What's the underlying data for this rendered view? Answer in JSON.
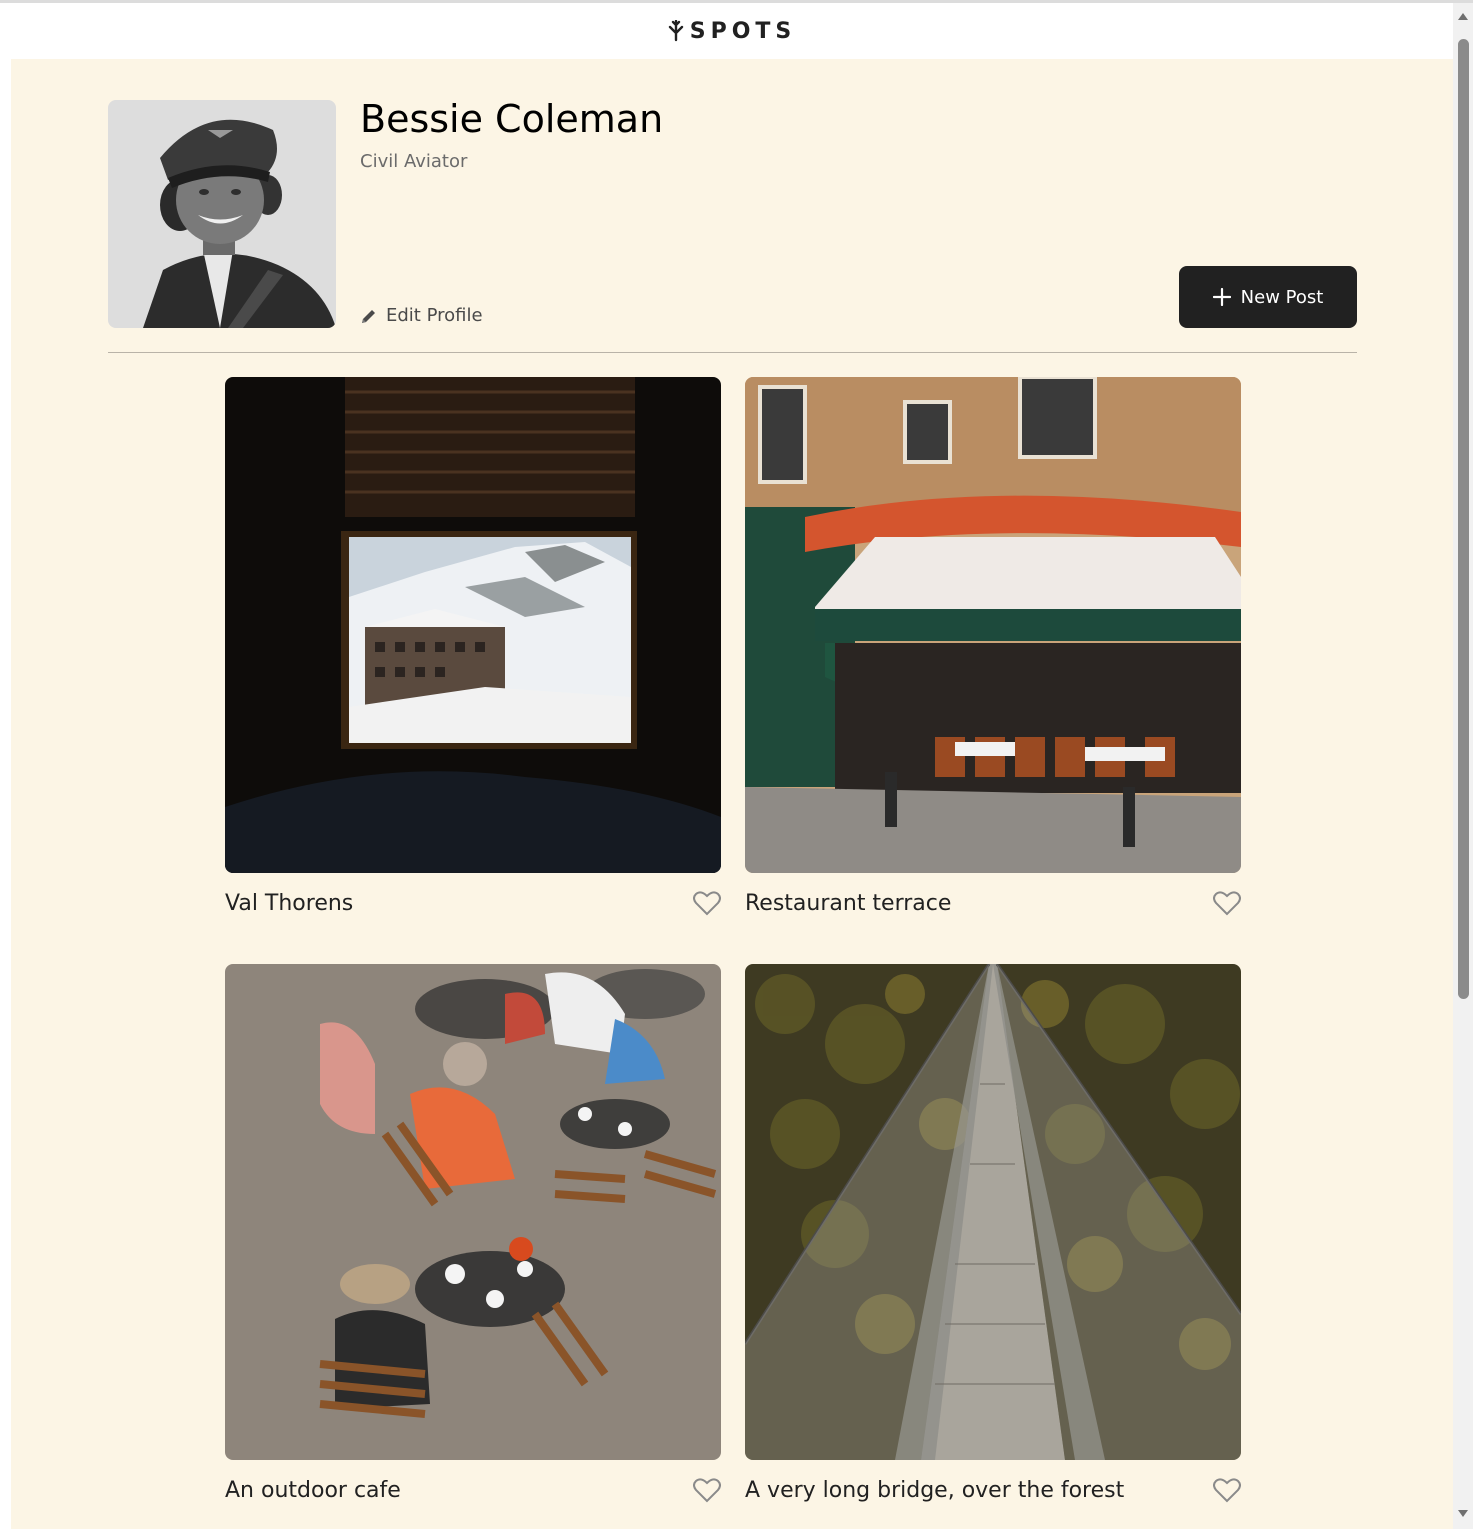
{
  "header": {
    "logo_text": "SPOTS"
  },
  "profile": {
    "name": "Bessie Coleman",
    "role": "Civil Aviator",
    "edit_label": "Edit Profile",
    "new_post_label": "New Post"
  },
  "cards": [
    {
      "title": "Val Thorens",
      "liked": false
    },
    {
      "title": "Restaurant terrace",
      "liked": false
    },
    {
      "title": "An outdoor cafe",
      "liked": false
    },
    {
      "title": "A very long bridge, over the forest",
      "liked": false
    }
  ],
  "colors": {
    "page_background": "#fcf5e5",
    "header_background": "#ffffff",
    "button_dark": "#212121",
    "text_secondary": "#6b6b6b"
  },
  "icons": [
    "logo-icon",
    "pencil-icon",
    "plus-icon",
    "heart-icon"
  ]
}
